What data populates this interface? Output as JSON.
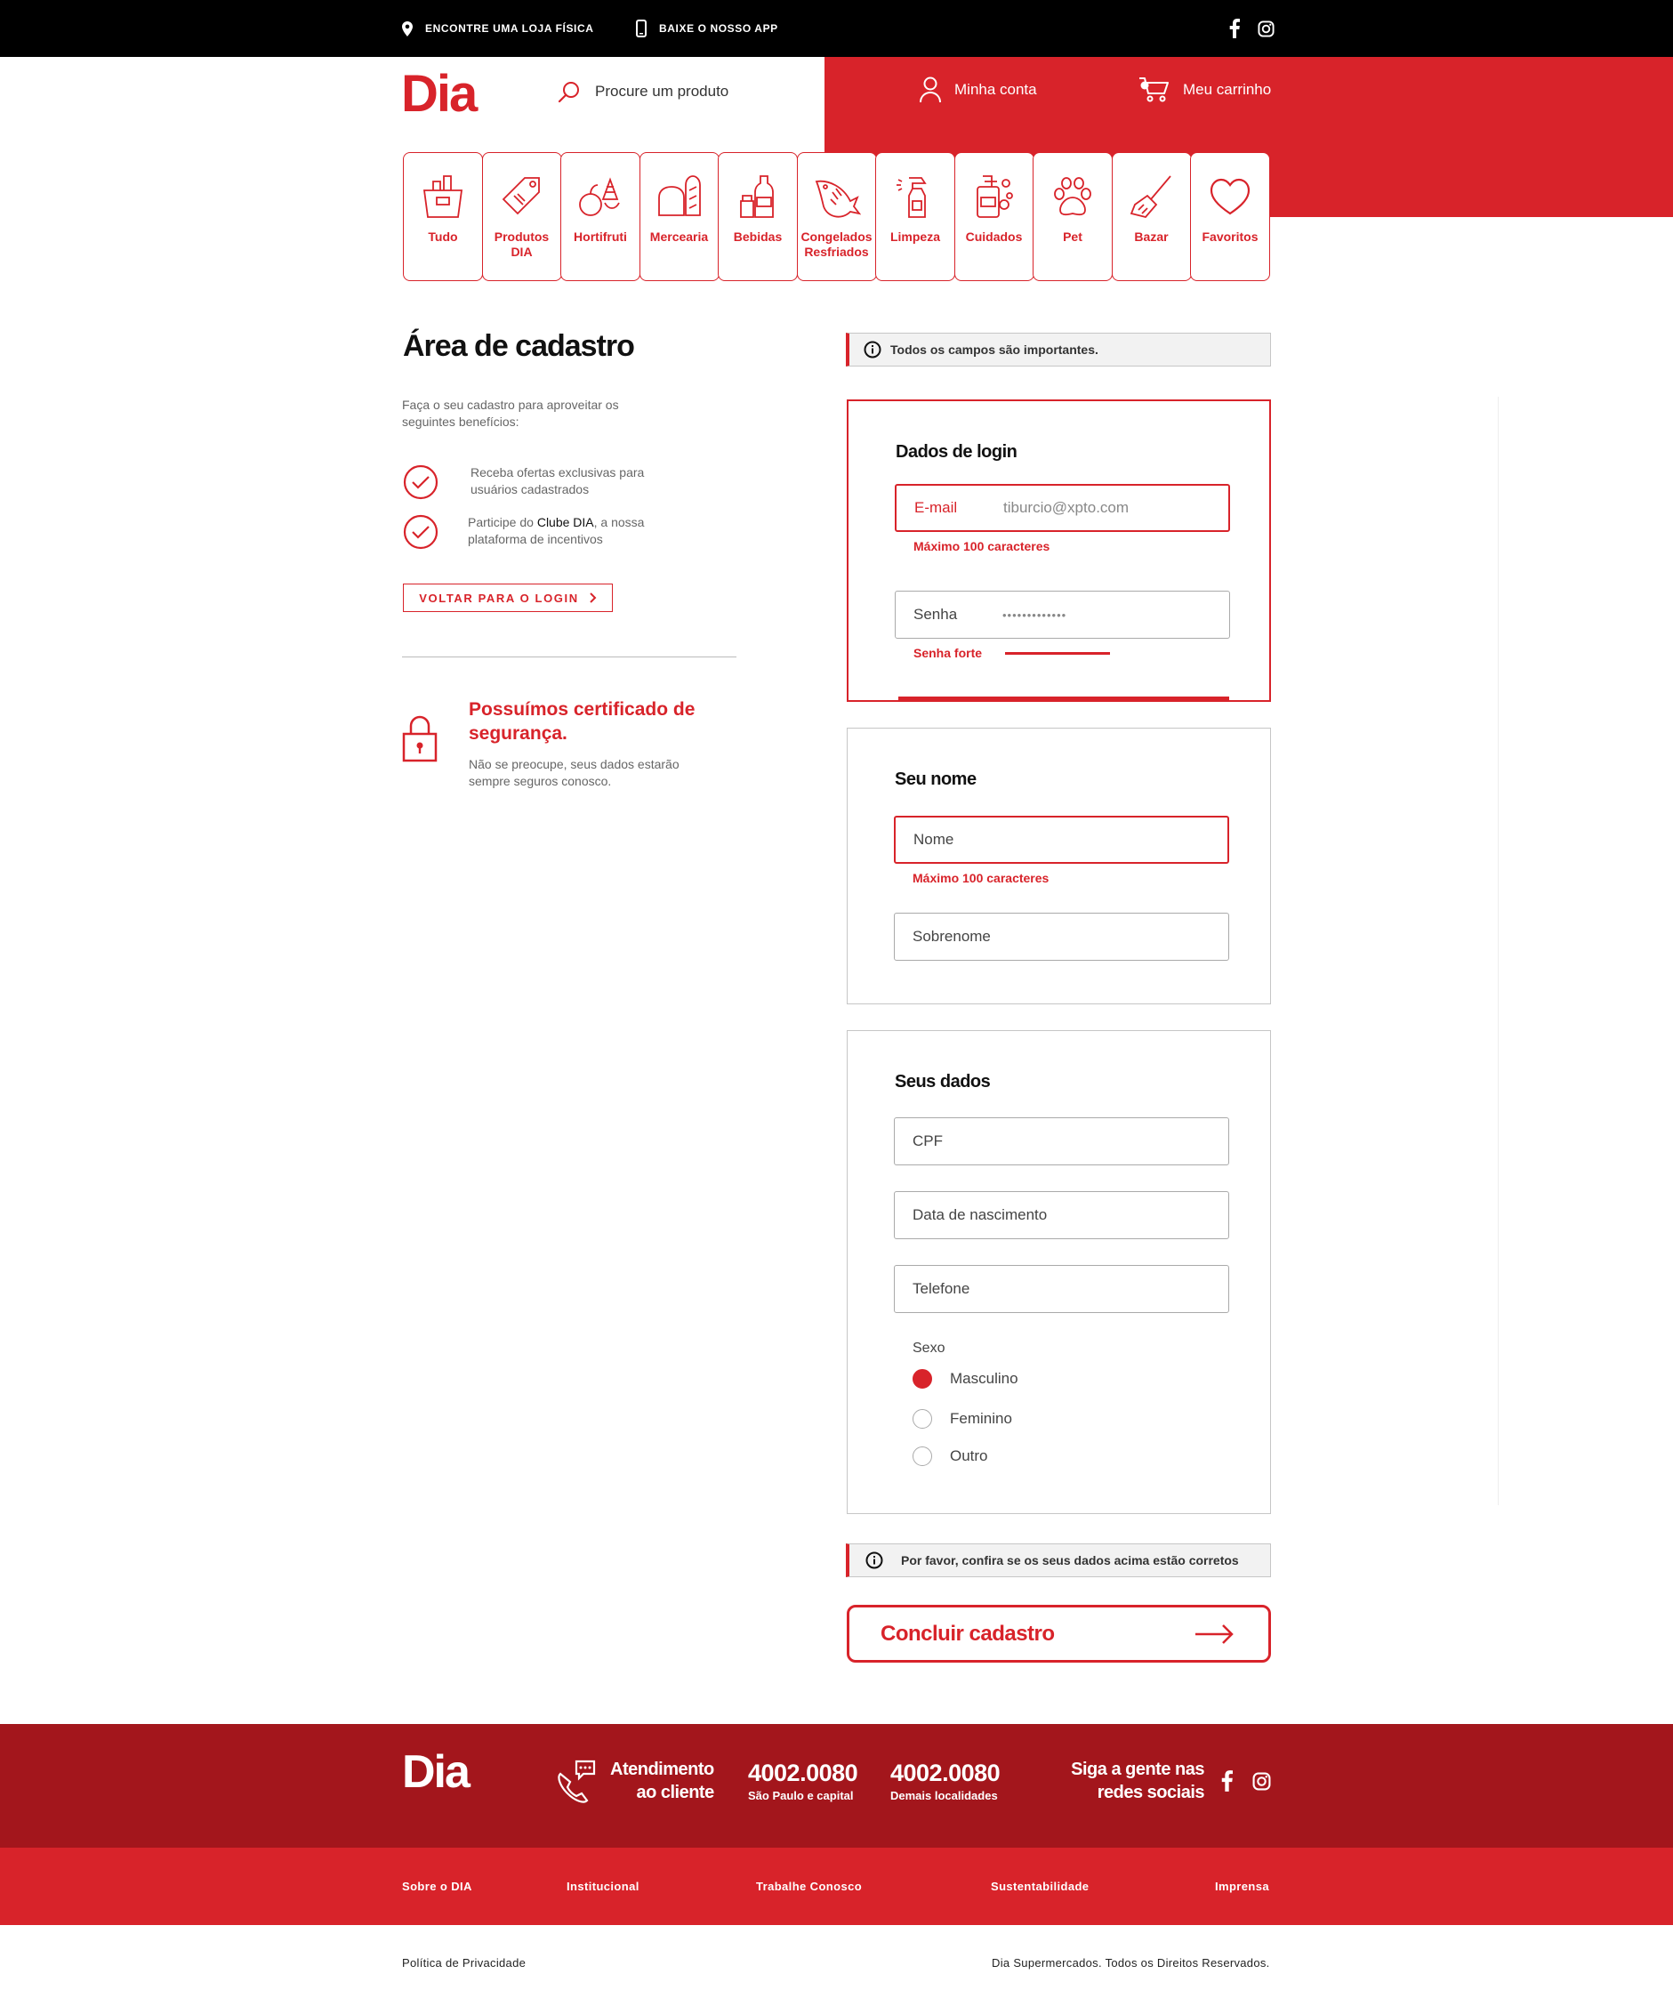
{
  "topbar": {
    "store_link": "ENCONTRE UMA LOJA FÍSICA",
    "app_link": "BAIXE O NOSSO APP",
    "social_icons": [
      "facebook-icon",
      "instagram-icon"
    ]
  },
  "header": {
    "logo": "Dia",
    "search_placeholder": "Procure um produto",
    "account": "Minha conta",
    "cart": "Meu carrinho"
  },
  "categories": [
    {
      "label": "Tudo",
      "icon": "grocery-bag-icon"
    },
    {
      "label": "Produtos DIA",
      "icon": "price-tag-icon"
    },
    {
      "label": "Hortifruti",
      "icon": "fruits-icon"
    },
    {
      "label": "Mercearia",
      "icon": "bread-icon"
    },
    {
      "label": "Bebidas",
      "icon": "bottles-icon"
    },
    {
      "label": "Congelados Resfriados",
      "icon": "fish-icon"
    },
    {
      "label": "Limpeza",
      "icon": "spray-bottle-icon"
    },
    {
      "label": "Cuidados",
      "icon": "soap-bottle-icon"
    },
    {
      "label": "Pet",
      "icon": "paw-icon"
    },
    {
      "label": "Bazar",
      "icon": "broom-icon"
    },
    {
      "label": "Favoritos",
      "icon": "heart-icon"
    }
  ],
  "left": {
    "title": "Área de cadastro",
    "intro": "Faça o seu cadastro para aproveitar os seguintes benefícios:",
    "benefit1": "Receba ofertas exclusivas para usuários cadastrados",
    "benefit2_pre": "Participe do ",
    "benefit2_link": "Clube DIA",
    "benefit2_post": ", a nossa plataforma de incentivos",
    "back_button": "VOLTAR PARA O LOGIN",
    "security_title": "Possuímos certificado de segurança.",
    "security_text": "Não se preocupe, seus dados estarão sempre seguros conosco."
  },
  "form": {
    "notice_top": "Todos os campos são importantes.",
    "login": {
      "title": "Dados de login",
      "email_label": "E-mail",
      "email_value": "tiburcio@xpto.com",
      "email_hint": "Máximo 100 caracteres",
      "password_label": "Senha",
      "password_value": "•••••••••••••",
      "password_hint": "Senha forte"
    },
    "name": {
      "title": "Seu nome",
      "first_label": "Nome",
      "first_hint": "Máximo 100 caracteres",
      "last_label": "Sobrenome"
    },
    "personal": {
      "title": "Seus dados",
      "cpf_label": "CPF",
      "birth_label": "Data de nascimento",
      "phone_label": "Telefone",
      "sex_label": "Sexo",
      "options": [
        "Masculino",
        "Feminino",
        "Outro"
      ],
      "selected": "Masculino"
    },
    "notice_bottom": "Por favor, confira se os seus dados acima estão corretos",
    "submit": "Concluir cadastro"
  },
  "footer": {
    "logo": "Dia",
    "service_line1": "Atendimento",
    "service_line2": "ao cliente",
    "phone1": {
      "number": "4002.0080",
      "label": "São Paulo e capital"
    },
    "phone2": {
      "number": "4002.0080",
      "label": "Demais localidades"
    },
    "social_line1": "Siga a gente nas",
    "social_line2": "redes sociais",
    "links": [
      "Sobre o DIA",
      "Institucional",
      "Trabalhe Conosco",
      "Sustentabilidade",
      "Imprensa"
    ],
    "privacy": "Política de Privacidade",
    "copyright": "Dia Supermercados. Todos os Direitos Reservados."
  },
  "colors": {
    "brand_red": "#d8232a",
    "footer_dark_red": "#a3161c"
  }
}
